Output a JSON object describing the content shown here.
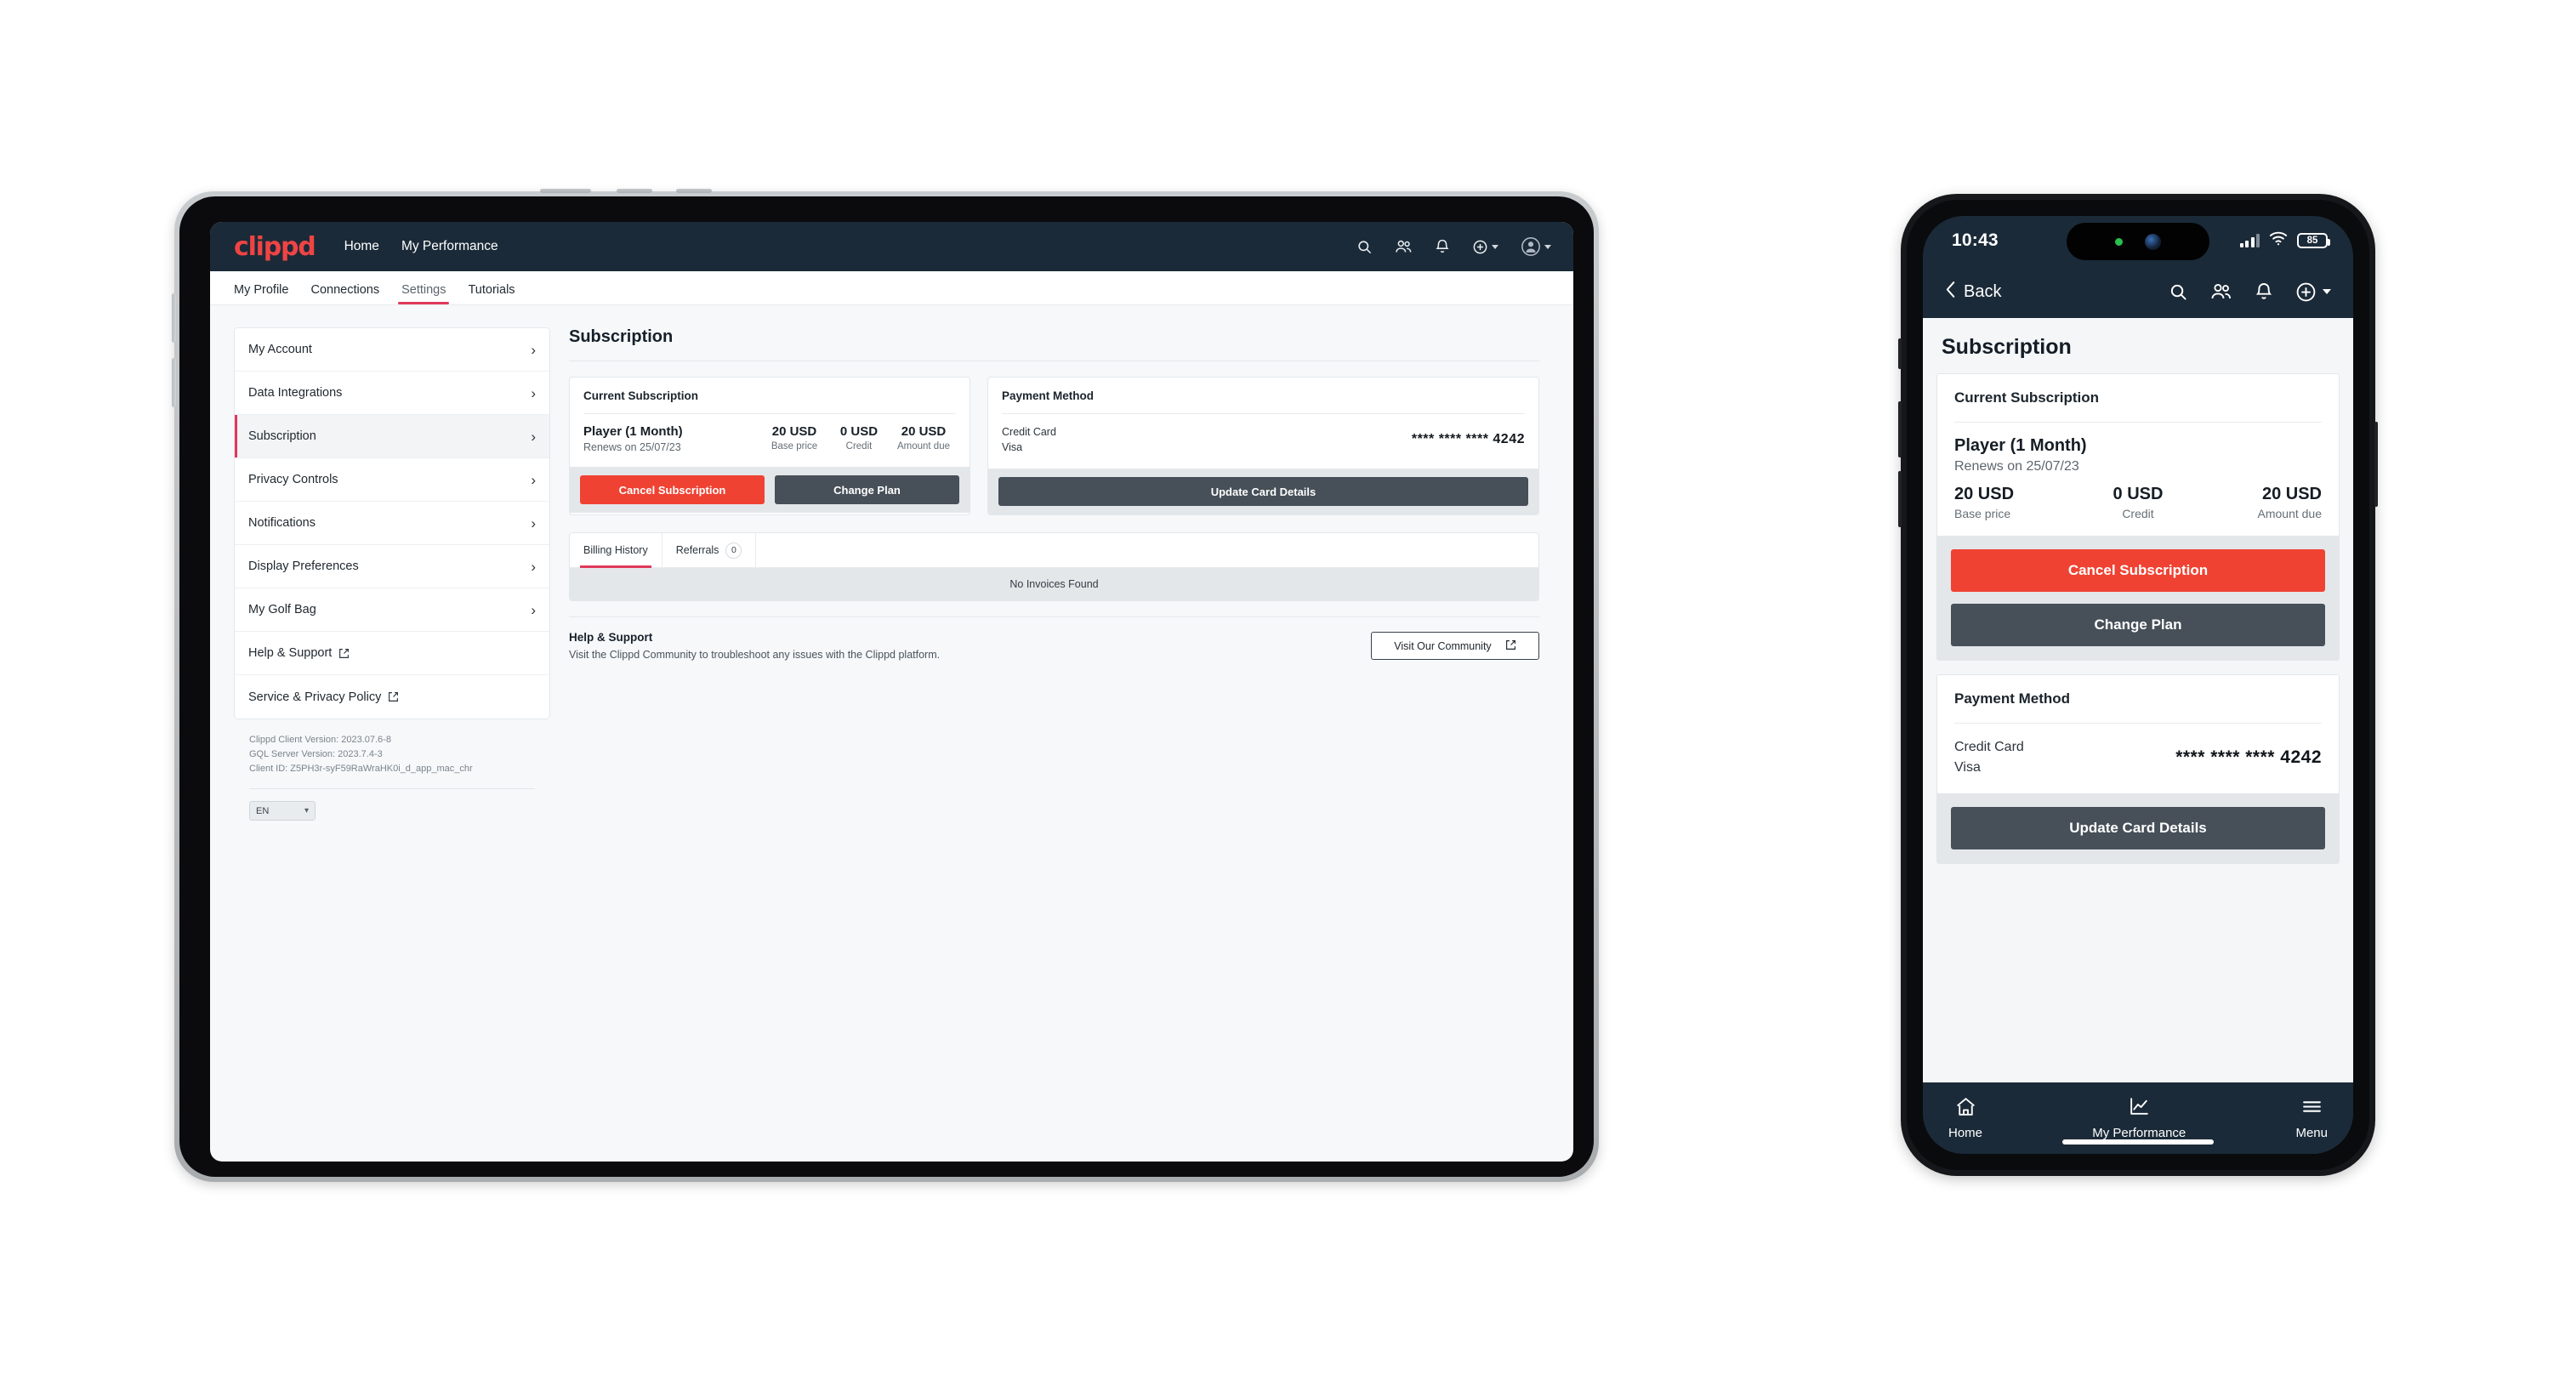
{
  "tablet": {
    "topbar": {
      "brand": "clippd",
      "nav": [
        {
          "label": "Home"
        },
        {
          "label": "My Performance"
        }
      ],
      "icons": [
        {
          "name": "search-icon"
        },
        {
          "name": "community-icon"
        },
        {
          "name": "notifications-bell-icon"
        },
        {
          "name": "add-circle-icon"
        },
        {
          "name": "user-avatar-icon"
        }
      ]
    },
    "tabs": [
      {
        "label": "My Profile",
        "active": false
      },
      {
        "label": "Connections",
        "active": false
      },
      {
        "label": "Settings",
        "active": true
      },
      {
        "label": "Tutorials",
        "active": false
      }
    ],
    "sidebar": {
      "items": [
        {
          "label": "My Account",
          "active": false,
          "external": false
        },
        {
          "label": "Data Integrations",
          "active": false,
          "external": false
        },
        {
          "label": "Subscription",
          "active": true,
          "external": false
        },
        {
          "label": "Privacy Controls",
          "active": false,
          "external": false
        },
        {
          "label": "Notifications",
          "active": false,
          "external": false
        },
        {
          "label": "Display Preferences",
          "active": false,
          "external": false
        },
        {
          "label": "My Golf Bag",
          "active": false,
          "external": false
        },
        {
          "label": "Help & Support",
          "active": false,
          "external": true
        },
        {
          "label": "Service & Privacy Policy",
          "active": false,
          "external": true
        }
      ],
      "meta": {
        "client_version": "Clippd Client Version: 2023.07.6-8",
        "server_version": "GQL Server Version: 2023.7.4-3",
        "client_id": "Client ID: Z5PH3r-syF59RaWraHK0i_d_app_mac_chr"
      },
      "language": {
        "value": "EN"
      }
    },
    "main": {
      "page_title": "Subscription",
      "current_subscription": {
        "title": "Current Subscription",
        "plan": "Player (1 Month)",
        "renews": "Renews on 25/07/23",
        "columns": [
          {
            "amount": "20 USD",
            "label": "Base price"
          },
          {
            "amount": "0 USD",
            "label": "Credit"
          },
          {
            "amount": "20 USD",
            "label": "Amount due"
          }
        ],
        "cancel_label": "Cancel Subscription",
        "change_plan_label": "Change Plan"
      },
      "payment_method": {
        "title": "Payment Method",
        "type": "Credit Card",
        "brand": "Visa",
        "number": "**** **** **** 4242",
        "update_label": "Update Card Details"
      },
      "history": {
        "tabs": [
          {
            "label": "Billing History",
            "badge": "",
            "active": true
          },
          {
            "label": "Referrals",
            "badge": "0",
            "active": false
          }
        ],
        "empty": "No Invoices Found"
      },
      "help": {
        "title": "Help & Support",
        "description": "Visit the Clippd Community to troubleshoot any issues with the Clippd platform.",
        "button_label": "Visit Our Community"
      }
    }
  },
  "phone": {
    "status": {
      "time": "10:43",
      "battery": "85"
    },
    "nav": {
      "back_label": "Back",
      "icons": [
        {
          "name": "search-icon"
        },
        {
          "name": "community-icon"
        },
        {
          "name": "notifications-bell-icon"
        },
        {
          "name": "add-circle-icon"
        }
      ]
    },
    "page_title": "Subscription",
    "current_subscription": {
      "title": "Current Subscription",
      "plan": "Player (1 Month)",
      "renews": "Renews on 25/07/23",
      "columns": [
        {
          "amount": "20 USD",
          "label": "Base price"
        },
        {
          "amount": "0 USD",
          "label": "Credit"
        },
        {
          "amount": "20 USD",
          "label": "Amount due"
        }
      ],
      "cancel_label": "Cancel Subscription",
      "change_plan_label": "Change Plan"
    },
    "payment_method": {
      "title": "Payment Method",
      "type": "Credit Card",
      "brand": "Visa",
      "number": "**** **** **** 4242",
      "update_label": "Update Card Details"
    },
    "tabbar": [
      {
        "label": "Home",
        "icon": "home-icon"
      },
      {
        "label": "My Performance",
        "icon": "chart-icon"
      },
      {
        "label": "Menu",
        "icon": "hamburger-menu-icon"
      }
    ]
  },
  "colors": {
    "brand_red": "#ef4444",
    "accent_pink": "#e0385a",
    "danger": "#ef4233",
    "dark_button": "#475059",
    "navy": "#1b2a38"
  }
}
